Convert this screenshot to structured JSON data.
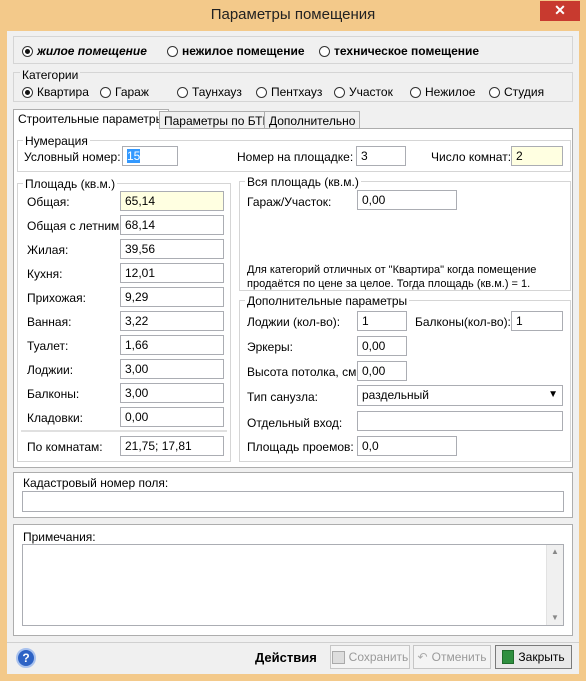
{
  "window": {
    "title": "Параметры помещения",
    "close_symbol": "✕"
  },
  "room_type": {
    "options": [
      "жилое помещение",
      "нежилое помещение",
      "техническое помещение"
    ],
    "selected": 0
  },
  "categories": {
    "label": "Категории",
    "options": [
      "Квартира",
      "Гараж",
      "Таунхауз",
      "Пентхауз",
      "Участок",
      "Нежилое",
      "Студия"
    ],
    "selected": 0
  },
  "tabs": [
    "Строительные параметры",
    "Параметры по БТИ",
    "Дополнительно"
  ],
  "numbering": {
    "title": "Нумерация",
    "conditional_number_label": "Условный номер:",
    "conditional_number_value": "15",
    "floor_number_label": "Номер на площадке:",
    "floor_number_value": "3",
    "rooms_label": "Число комнат:",
    "rooms_value": "2"
  },
  "area": {
    "title": "Площадь (кв.м.)",
    "rows": [
      {
        "label": "Общая:",
        "value": "65,14"
      },
      {
        "label": "Общая с летними:",
        "value": "68,14"
      },
      {
        "label": "Жилая:",
        "value": "39,56"
      },
      {
        "label": "Кухня:",
        "value": "12,01"
      },
      {
        "label": "Прихожая:",
        "value": "9,29"
      },
      {
        "label": "Ванная:",
        "value": "3,22"
      },
      {
        "label": "Туалет:",
        "value": "1,66"
      },
      {
        "label": "Лоджии:",
        "value": "3,00"
      },
      {
        "label": "Балконы:",
        "value": "3,00"
      },
      {
        "label": "Кладовки:",
        "value": "0,00"
      }
    ],
    "by_rooms_label": "По комнатам:",
    "by_rooms_value": "21,75; 17,81"
  },
  "total_area": {
    "title": "Вся площадь (кв.м.)",
    "garage_label": "Гараж/Участок:",
    "garage_value": "0,00",
    "note_line1": "Для категорий отличных от \"Квартира\" когда помещение",
    "note_line2": "продаётся по цене за целое. Тогда площадь (кв.м.) = 1."
  },
  "additional": {
    "title": "Дополнительные параметры",
    "loggias_label": "Лоджии (кол-во):",
    "loggias_value": "1",
    "balconies_label": "Балконы(кол-во):",
    "balconies_value": "1",
    "bay_windows_label": "Эркеры:",
    "bay_windows_value": "0,00",
    "ceiling_label": "Высота потолка, см:",
    "ceiling_value": "0,00",
    "bathroom_label": "Тип санузла:",
    "bathroom_value": "раздельный",
    "entrance_label": "Отдельный вход:",
    "entrance_value": "",
    "openings_label": "Площадь проемов:",
    "openings_value": "0,0"
  },
  "cadastral": {
    "label": "Кадастровый номер поля:",
    "value": ""
  },
  "notes": {
    "label": "Примечания:",
    "value": ""
  },
  "footer": {
    "help_symbol": "?",
    "actions_label": "Действия",
    "save_label": "Сохранить",
    "cancel_label": "Отменить",
    "close_label": "Закрыть"
  },
  "colors": {
    "frame": "#f3c98a",
    "close": "#c83a2f",
    "highlight": "#ffffe1",
    "selection": "#3399ff"
  }
}
